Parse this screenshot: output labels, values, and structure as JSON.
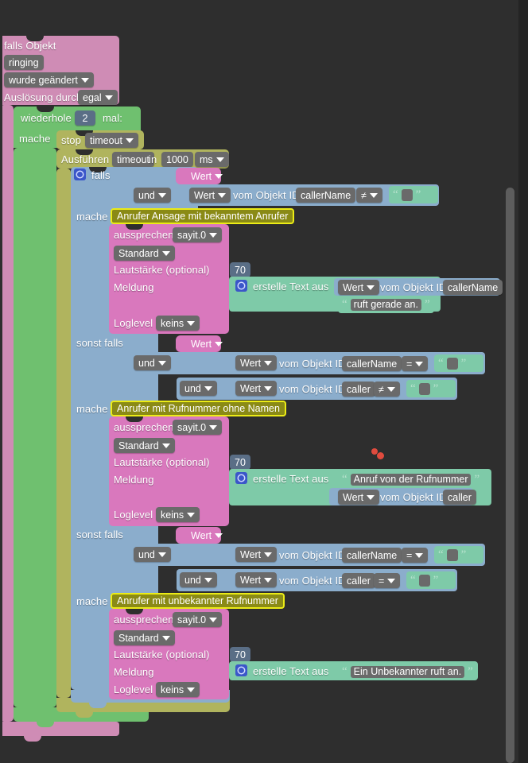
{
  "app": {
    "kind": "blockly-visual-script-editor",
    "background": "#2e2e2e",
    "language": "de"
  },
  "colors": {
    "trigger_pink": "#cf8cb5",
    "loop_green": "#6fc06f",
    "timeout_olive": "#b0b45e",
    "logic_blue": "#8badcc",
    "speak_magenta": "#d978bd",
    "text_mint": "#7ecaa8",
    "comment_border": "#ecec16",
    "comment_fill": "#8a8a16",
    "cursor_red": "#e04b3e"
  },
  "trigger": {
    "title": "falls Objekt",
    "object_id": "ringing",
    "condition": "wurde geändert",
    "ack_label": "Auslösung durch",
    "ack_value": "egal"
  },
  "loop": {
    "repeat_label": "wiederhole",
    "count": "2",
    "times_label": "mal:",
    "do_label": "mache"
  },
  "timeout": {
    "stop_label": "stop",
    "stop_target": "timeout",
    "run_label": "Ausführen",
    "run_target": "timeout",
    "in_label": "in",
    "delay": "1000",
    "unit": "ms"
  },
  "if_block": {
    "gear_icon": "gear-icon",
    "if_label": "falls",
    "elseif_label": "sonst falls",
    "do_label": "mache",
    "value_label": "Wert",
    "and_label": "und",
    "of_object_id_label": "vom Objekt ID"
  },
  "branches": [
    {
      "id": "branch-known-caller",
      "kind": "if",
      "condition_header": "Wert",
      "rows": [
        {
          "and": "und",
          "value": "Wert",
          "prefix": "vom Objekt ID",
          "object": "callerName",
          "operator": "≠",
          "compare": ""
        }
      ],
      "comment": "Anrufer Ansage mit bekanntem Anrufer",
      "speak": {
        "speak_label": "aussprechen",
        "instance": "sayit.0",
        "voice": "Standard",
        "volume_label": "Lautstärke (optional)",
        "volume": "70",
        "message_label": "Meldung",
        "loglevel_label": "Loglevel",
        "loglevel": "keins"
      },
      "message": {
        "create_text_label": "erstelle Text aus",
        "parts": [
          {
            "type": "value",
            "value_label": "Wert",
            "prefix": "vom Objekt ID",
            "object": "callerName"
          },
          {
            "type": "text",
            "text": "ruft gerade an."
          }
        ]
      }
    },
    {
      "id": "branch-number-no-name",
      "kind": "elseif",
      "condition_header": "Wert",
      "rows": [
        {
          "and": "und",
          "value": "Wert",
          "prefix": "vom Objekt ID",
          "object": "callerName",
          "operator": "=",
          "compare": ""
        },
        {
          "and": "und",
          "value": "Wert",
          "prefix": "vom Objekt ID",
          "object": "caller",
          "operator": "≠",
          "compare": ""
        }
      ],
      "comment": "Anrufer mit Rufnummer ohne Namen",
      "speak": {
        "speak_label": "aussprechen",
        "instance": "sayit.0",
        "voice": "Standard",
        "volume_label": "Lautstärke (optional)",
        "volume": "70",
        "message_label": "Meldung",
        "loglevel_label": "Loglevel",
        "loglevel": "keins"
      },
      "message": {
        "create_text_label": "erstelle Text aus",
        "parts": [
          {
            "type": "text",
            "text": "Anruf von  der Rufnummer"
          },
          {
            "type": "value",
            "value_label": "Wert",
            "prefix": "vom Objekt ID",
            "object": "caller"
          }
        ]
      }
    },
    {
      "id": "branch-unknown-number",
      "kind": "elseif",
      "condition_header": "Wert",
      "rows": [
        {
          "and": "und",
          "value": "Wert",
          "prefix": "vom Objekt ID",
          "object": "callerName",
          "operator": "=",
          "compare": ""
        },
        {
          "and": "und",
          "value": "Wert",
          "prefix": "vom Objekt ID",
          "object": "caller",
          "operator": "=",
          "compare": ""
        }
      ],
      "comment": "Anrufer mit unbekannter Rufnummer",
      "speak": {
        "speak_label": "aussprechen",
        "instance": "sayit.0",
        "voice": "Standard",
        "volume_label": "Lautstärke (optional)",
        "volume": "70",
        "message_label": "Meldung",
        "loglevel_label": "Loglevel",
        "loglevel": "keins"
      },
      "message": {
        "create_text_label": "erstelle Text aus",
        "parts": [
          {
            "type": "text",
            "text": "Ein Unbekannter ruft an."
          }
        ]
      }
    }
  ],
  "scrollbar": {
    "name": "vertical-scrollbar"
  },
  "cursor": {
    "name": "cursor-marker",
    "dots": 2
  }
}
